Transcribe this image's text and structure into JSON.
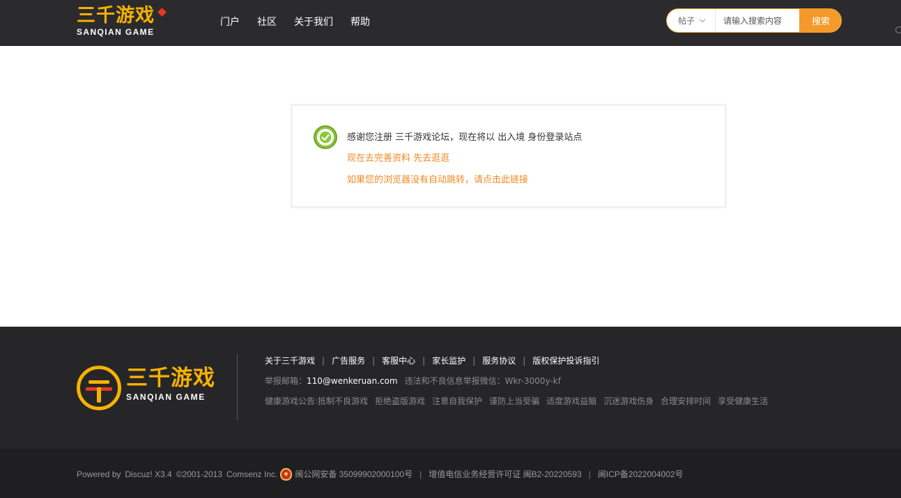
{
  "header": {
    "logo_cn": "三千游戏",
    "logo_en": "SANQIAN GAME",
    "nav": [
      "门户",
      "社区",
      "关于我们",
      "帮助"
    ],
    "search": {
      "type_label": "帖子",
      "placeholder": "请输入搜索内容",
      "button_label": "搜索"
    }
  },
  "message": {
    "main_text": "感谢您注册 三千游戏论坛，现在将以 出入境 身份登录站点",
    "link_profile": "现在去完善资料",
    "link_browse": "先去逛逛",
    "redirect_text": "如果您的浏览器没有自动跳转，请点击此链接"
  },
  "footer": {
    "logo_cn": "三千游戏",
    "logo_en": "SANQIAN GAME",
    "links": [
      "关于三千游戏",
      "广告服务",
      "客服中心",
      "家长监护",
      "服务协议",
      "版权保护投诉指引"
    ],
    "link_separator": "|",
    "report_email_label": "举报邮箱：",
    "report_email": "110@wenkeruan.com",
    "report_wechat": "违法和不良信息举报微信：Wkr-3000y-kf",
    "notice": [
      "健康游戏公告:抵制不良游戏",
      "拒绝盗版游戏",
      "注意自我保护",
      "谨防上当受骗",
      "适度游戏益脑",
      "沉迷游戏伤身",
      "合理安排时间",
      "享受健康生活"
    ]
  },
  "bottom": {
    "powered_by": "Powered by",
    "discuz": "Discuz! X3.4",
    "copyright": "©2001-2013",
    "company": "Comsenz Inc.",
    "police_record": "闽公网安备 35099902000100号",
    "license": "增值电信业务经营许可证 闽B2-20220593",
    "icp": "闽ICP备2022004002号",
    "separator": "|"
  },
  "colors": {
    "header_bg": "#2b2b2d",
    "accent": "#f39a2a",
    "logo_yellow": "#f7b200",
    "link_orange": "#f08a24",
    "footer_bg": "#262629",
    "bottom_bg": "#1f1f21"
  }
}
